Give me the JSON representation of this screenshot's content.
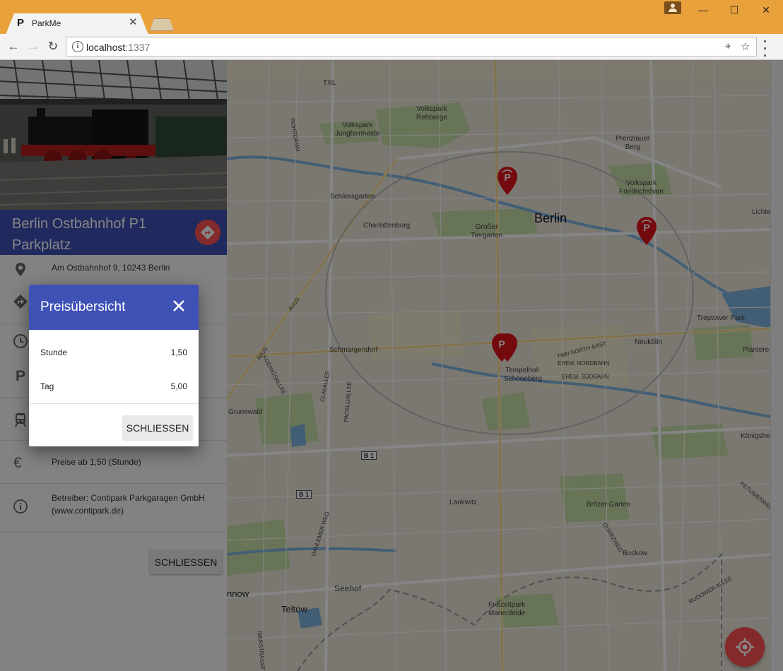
{
  "browser": {
    "tab_title": "ParkMe",
    "tab_favicon": "P",
    "url_host": "localhost",
    "url_port": ":1337"
  },
  "map": {
    "labels": {
      "txl": "TXL",
      "volkspark_rehberge": "Volkspark\nRehberge",
      "volkspark_jungfernheide": "Volkspark\nJungfernheide",
      "rohrdamm": "ROHRDAMM",
      "schlossgarten": "Schlossgarten",
      "charlottenburg": "Charlottenburg",
      "grosser_tiergarten": "Großer\nTiergarten",
      "berlin": "Berlin",
      "prenzlauer_berg": "Prenzlauer\nBerg",
      "volkspark_friedrichshain": "Volkspark\nFriedrichshain",
      "lichte": "Lichte",
      "avus": "AVUS",
      "treptower_park": "Treptower Park",
      "schmargendorf": "Schmargendorf",
      "neukoelln": "Neukölln",
      "plantere": "Plantere",
      "tempelhof": "Tempelhof-\nSchöneberg",
      "twn_north_east": "TWN NORTH-EAST",
      "ehem_nordbahn": "EHEM. NORDBAHN",
      "ehem_suedbahn": "EHEM. SÜDBAHN",
      "grunewald": "Grunewald",
      "koenigsallee": "KOENIGSALLEE",
      "clayallee": "CLAYALLEE",
      "pacelliallee": "PACELLIALLEE",
      "koenigshe": "Königshe",
      "b1_a": "B 1",
      "b1_b": "B 1",
      "lankwitz": "Lankwitz",
      "britzer_garten": "Britzer Garten",
      "petuniengweg": "PETUNIENWEG",
      "dahlemer_weg": "DAHLEMER WEG",
      "quarzweg": "QUARZWEG",
      "buckow": "Buckow",
      "nnow": "nnow",
      "seehof": "Seehof",
      "rudower_allee": "RUDOWER ALLEE",
      "teltow": "Teltow",
      "freizeitpark": "Freizeitpark\nMarienfelde",
      "iserstrasse": "ISERSTRASSE"
    }
  },
  "detail": {
    "title": "Berlin Ostbahnhof P1 Parkplatz",
    "address": "Am Ostbahnhof 9, 10243 Berlin",
    "prices": "Preise ab 1,50 (Stunde)",
    "operator": "Betreiber: Contipark Parkgaragen GmbH (www.contipark.de)",
    "close_label": "SCHLIESSEN"
  },
  "dialog": {
    "title": "Preisübersicht",
    "rows": [
      {
        "label": "Stunde",
        "value": "1,50"
      },
      {
        "label": "Tag",
        "value": "5,00"
      }
    ],
    "close_label": "SCHLIESSEN"
  },
  "colors": {
    "primary": "#3f51b5",
    "accent": "#ff5252",
    "chrome": "#e9a23b"
  }
}
